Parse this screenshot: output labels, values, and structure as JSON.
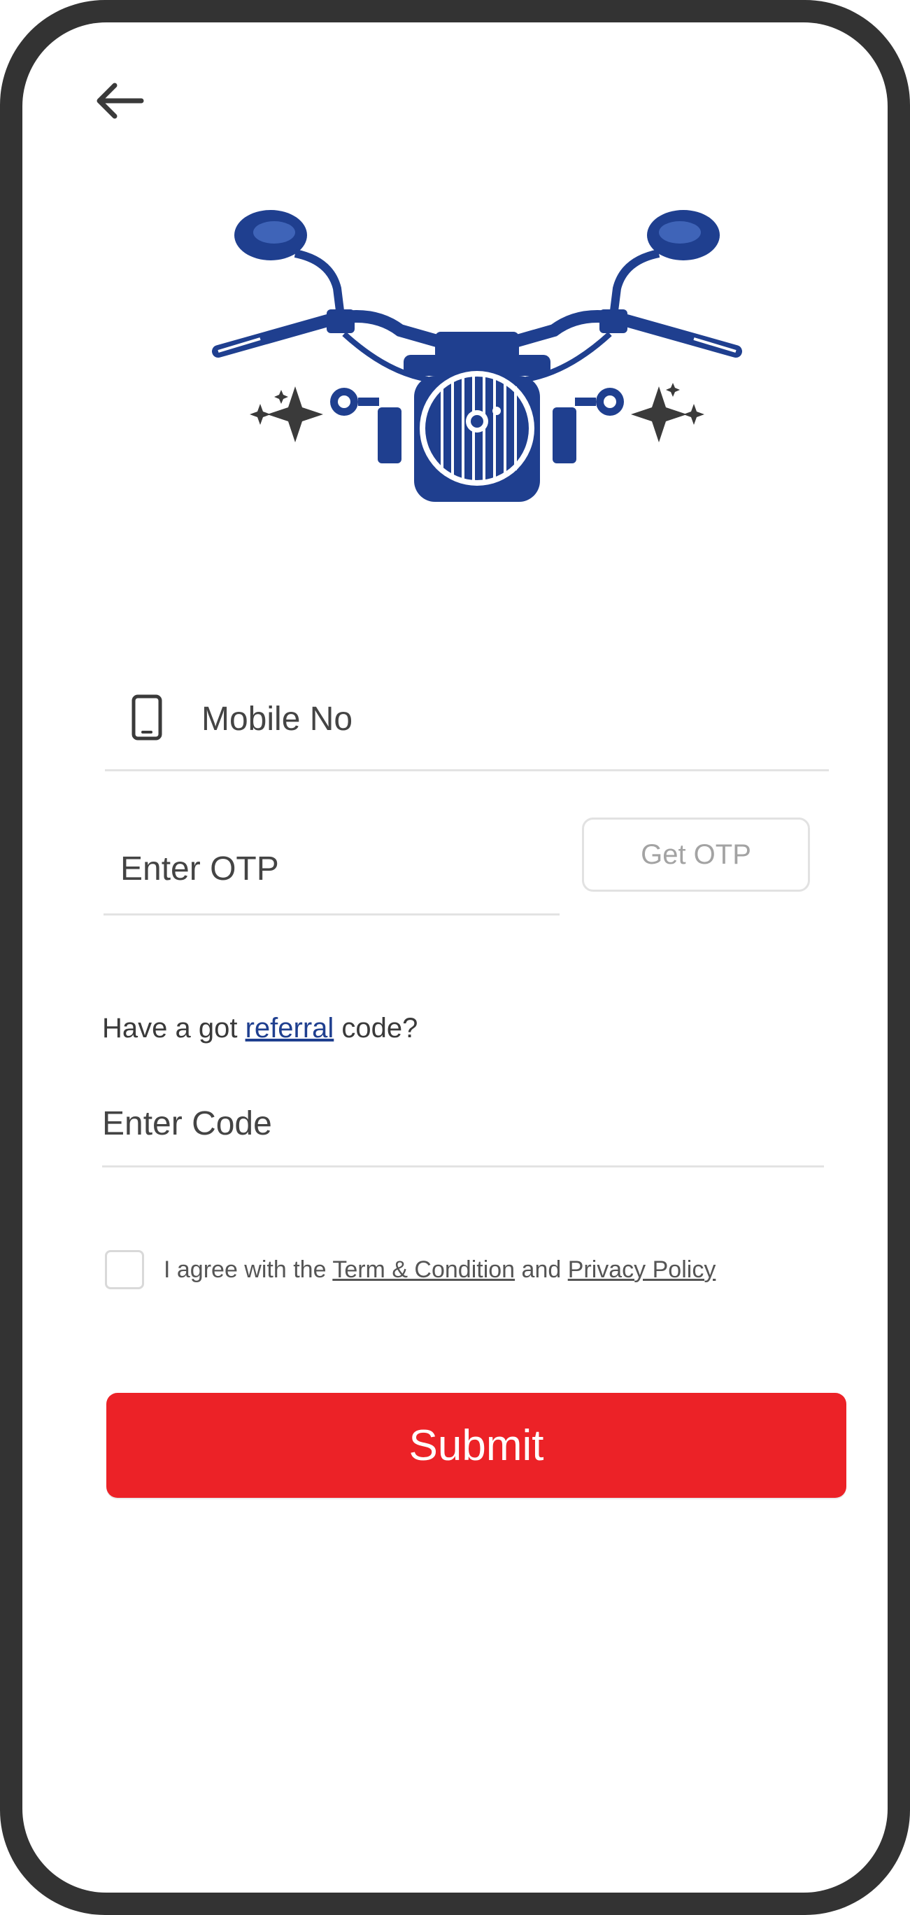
{
  "colors": {
    "frame": "#333333",
    "brand_blue": "#1f3f8f",
    "submit_red": "#ec2227",
    "sparkle": "#3a3a3a"
  },
  "icons": {
    "back": "arrow-left-icon",
    "mobile": "mobile-phone-icon",
    "hero": "motorcycle-illustration",
    "sparkle": "sparkle-icon"
  },
  "form": {
    "mobile_placeholder": "Mobile No",
    "mobile_value": "",
    "otp_placeholder": "Enter OTP",
    "otp_value": "",
    "get_otp_label": "Get OTP"
  },
  "referral": {
    "prompt_before": "Have a got ",
    "link_text": "referral",
    "prompt_after": " code?",
    "code_placeholder": "Enter Code",
    "code_value": ""
  },
  "agreement": {
    "checked": false,
    "text_before": "I agree with the ",
    "terms_link": "Term & Condition",
    "text_middle": " and ",
    "privacy_link": "Privacy Policy"
  },
  "actions": {
    "submit_label": "Submit"
  }
}
